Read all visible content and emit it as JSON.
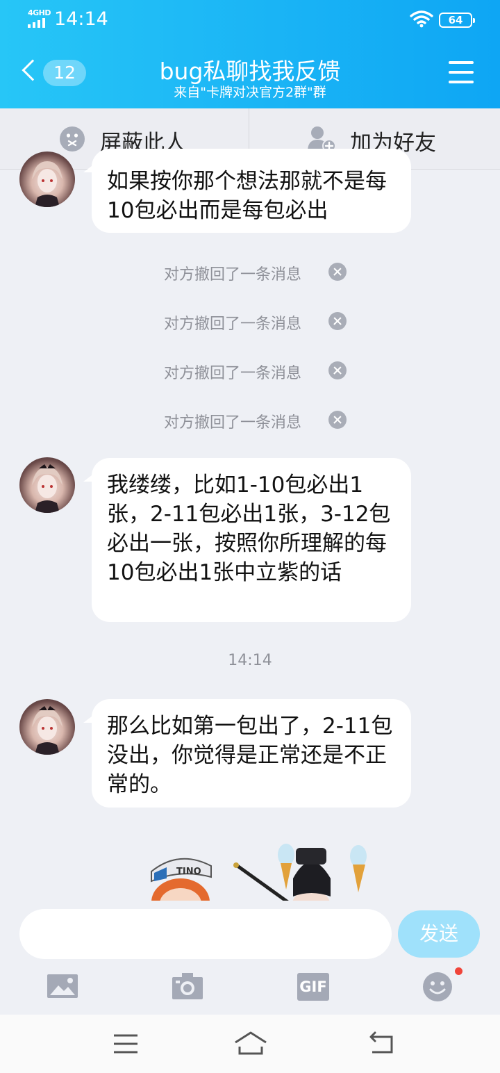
{
  "status_bar": {
    "network": "4GHD",
    "time": "14:14",
    "battery": "64"
  },
  "header": {
    "unread_count": "12",
    "title": "bug私聊找我反馈",
    "subtitle": "来自\"卡牌对决官方2群\"群"
  },
  "actions": {
    "block": "屏蔽此人",
    "add_friend": "加为好友"
  },
  "messages": {
    "m1": "如果按你那个想法那就不是每10包必出而是每包必出",
    "recalled": [
      "对方撤回了一条消息",
      "对方撤回了一条消息",
      "对方撤回了一条消息",
      "对方撤回了一条消息"
    ],
    "m2": "我缕缕，比如1-10包必出1张，2-11包必出1张，3-12包必出一张，按照你所理解的每10包必出1张中立紫的话",
    "timestamp": "14:14",
    "m3": "那么比如第一包出了，2-11包没出，你觉得是正常还是不正常的。"
  },
  "sticker": {
    "text": "TINO"
  },
  "input": {
    "placeholder": "",
    "send_label": "发送"
  },
  "toolbar": {
    "gif_label": "GIF"
  },
  "colors": {
    "header_start": "#27c6f7",
    "header_end": "#0ea6f4",
    "send_button": "#9fe1fb",
    "badge": "#f0453a",
    "background": "#eef0f5"
  },
  "icons": [
    "back-chevron-icon",
    "menu-icon",
    "block-icon",
    "add-friend-icon",
    "recall-close-icon",
    "image-icon",
    "camera-icon",
    "gif-icon",
    "emoji-icon",
    "nav-menu-icon",
    "nav-home-icon",
    "nav-back-icon"
  ]
}
